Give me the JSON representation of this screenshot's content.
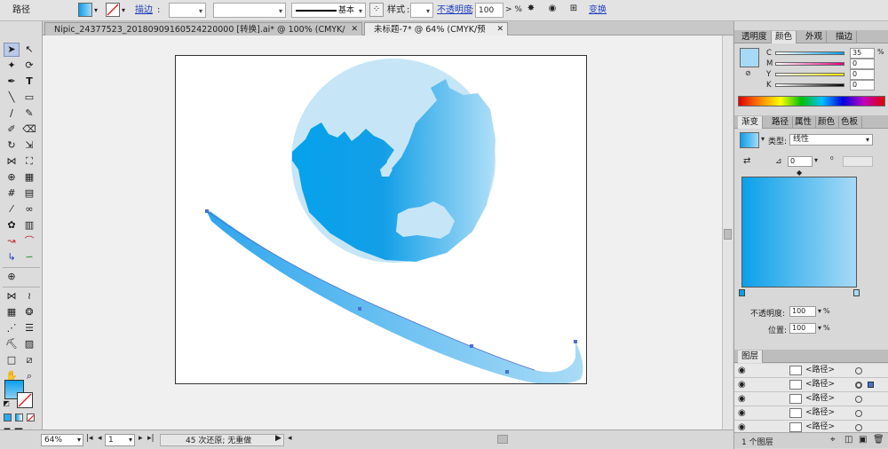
{
  "control_bar": {
    "object_label": "路径",
    "stroke_label": "描边",
    "stroke_style_label": "基本",
    "style_label": "样式",
    "opacity_label": "不透明度",
    "opacity_value": "100",
    "opacity_unit": ">  %",
    "transform_label": "变换",
    "fill_color": "#2aa9ee"
  },
  "tabs": [
    {
      "label": "Nipic_24377523_20180909160524220000  [转换].ai* @ 100% (CMYK/预览)",
      "active": false
    },
    {
      "label": "未标题-7* @ 64% (CMYK/预览)",
      "active": true
    }
  ],
  "status_bar": {
    "zoom": "64%",
    "page": "1",
    "history": "45 次还原; 无重做"
  },
  "color_panel": {
    "tabs": [
      "透明度",
      "颜色",
      "外观",
      "描边"
    ],
    "channels": [
      {
        "label": "C",
        "value": "35"
      },
      {
        "label": "M",
        "value": "0"
      },
      {
        "label": "Y",
        "value": "0"
      },
      {
        "label": "K",
        "value": "0"
      }
    ],
    "swatch_color": "#a7daf6"
  },
  "gradient_panel": {
    "tabs": [
      "渐变",
      "路径",
      "属性",
      "颜色",
      "色板"
    ],
    "type_label": "类型:",
    "type_value": "线性",
    "angle_value": "0",
    "opacity_label": "不透明度:",
    "opacity_value": "100",
    "location_label": "位置:",
    "location_value": "100",
    "percent": "%",
    "start_color": "#0aa0ea",
    "end_color": "#a7daf6"
  },
  "layers_panel": {
    "title": "图层",
    "rows": [
      "<路径>",
      "<路径>",
      "<路径>",
      "<路径>",
      "<路径>"
    ],
    "footer": "1 个图层"
  },
  "artwork": {
    "globe_light": "#c6e6f7",
    "globe_dark": "#05a2ec",
    "globe_mid": "#a7d9f6"
  }
}
